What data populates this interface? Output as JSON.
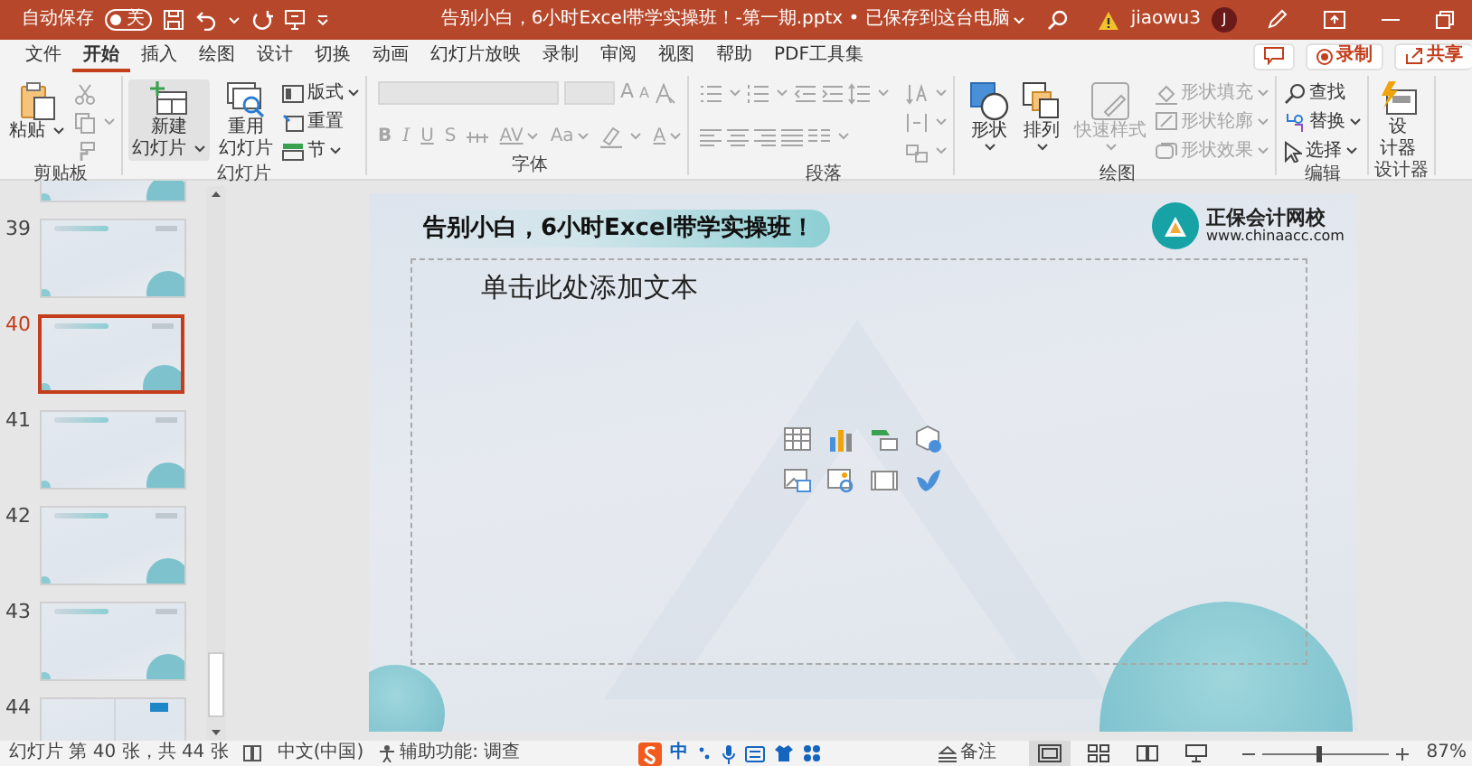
{
  "title_bar": {
    "autosave_label": "自动保存",
    "autosave": {
      "on": false,
      "label": "关"
    },
    "document_title": "告别小白，6小时Excel带学实操班！-第一期.pptx • 已保存到这台电脑",
    "account": "jiaowu3",
    "avatar_initial": "J"
  },
  "menu_tabs": [
    {
      "label": "文件",
      "selected": false
    },
    {
      "label": "开始",
      "selected": true
    },
    {
      "label": "插入",
      "selected": false
    },
    {
      "label": "绘图",
      "selected": false
    },
    {
      "label": "设计",
      "selected": false
    },
    {
      "label": "切换",
      "selected": false
    },
    {
      "label": "动画",
      "selected": false
    },
    {
      "label": "幻灯片放映",
      "selected": false
    },
    {
      "label": "录制",
      "selected": false
    },
    {
      "label": "审阅",
      "selected": false
    },
    {
      "label": "视图",
      "selected": false
    },
    {
      "label": "帮助",
      "selected": false
    },
    {
      "label": "PDF工具集",
      "selected": false
    }
  ],
  "record_button": "录制",
  "share_button": "共享",
  "ribbon": {
    "groups": [
      {
        "kind": "clipboard",
        "label": "剪贴板",
        "items": [
          {
            "lines": [
              "粘贴"
            ],
            "disabled": false
          },
          {
            "disabled": true
          },
          {
            "disabled": true
          },
          {
            "disabled": true
          }
        ]
      },
      {
        "kind": "slides",
        "label": "幻灯片",
        "items": [
          {
            "lines": [
              "新建",
              "幻灯片"
            ],
            "disabled": false
          },
          {
            "lines": [
              "重用",
              "幻灯片"
            ],
            "disabled": false
          },
          {
            "lines": [
              "版式"
            ],
            "disabled": false
          },
          {
            "lines": [
              "重置"
            ],
            "disabled": false
          },
          {
            "lines": [
              "节"
            ],
            "disabled": false
          }
        ]
      },
      {
        "kind": "font",
        "label": "字体",
        "items": [
          {
            "disabled": true
          },
          {
            "disabled": true
          },
          {
            "lines": [
              "A"
            ],
            "disabled": true
          },
          {
            "lines": [
              "A"
            ],
            "disabled": true
          },
          {
            "disabled": true
          },
          {
            "lines": [
              "B"
            ],
            "disabled": true
          },
          {
            "lines": [
              "I"
            ],
            "disabled": true
          },
          {
            "lines": [
              "U"
            ],
            "disabled": true
          },
          {
            "lines": [
              "S"
            ],
            "disabled": true
          },
          {
            "disabled": true
          },
          {
            "lines": [
              "AV"
            ],
            "disabled": true
          },
          {
            "lines": [
              "Aa"
            ],
            "disabled": true
          },
          {
            "disabled": true
          },
          {
            "lines": [
              "A"
            ],
            "disabled": true
          }
        ]
      },
      {
        "kind": "paragraph",
        "label": "段落",
        "items": [
          {
            "disabled": true
          },
          {
            "disabled": true
          },
          {
            "disabled": true
          },
          {
            "disabled": true
          },
          {
            "disabled": true
          },
          {
            "disabled": true
          },
          {
            "disabled": true
          },
          {
            "disabled": true
          },
          {
            "disabled": true
          },
          {
            "disabled": true
          },
          {
            "disabled": true
          },
          {
            "disabled": true
          },
          {
            "disabled": true
          }
        ]
      },
      {
        "kind": "drawing",
        "label": "绘图",
        "items": [
          {
            "lines": [
              "形状"
            ],
            "disabled": false
          },
          {
            "lines": [
              "排列"
            ],
            "disabled": false
          },
          {
            "lines": [
              "快速样式"
            ],
            "disabled": true
          },
          {
            "lines": [
              "形状填充"
            ],
            "disabled": true
          },
          {
            "lines": [
              "形状轮廓"
            ],
            "disabled": true
          },
          {
            "lines": [
              "形状效果"
            ],
            "disabled": true
          }
        ]
      },
      {
        "kind": "editing",
        "label": "编辑",
        "items": [
          {
            "lines": [
              "查找"
            ],
            "disabled": false
          },
          {
            "lines": [
              "替换"
            ],
            "disabled": false
          },
          {
            "lines": [
              "选择"
            ],
            "disabled": false
          }
        ]
      },
      {
        "kind": "designer",
        "label": "设计器",
        "items": [
          {
            "lines": [
              "设",
              "计器"
            ],
            "disabled": false
          }
        ]
      }
    ]
  },
  "slides": [
    {
      "kind": "plain",
      "selected": false
    },
    {
      "number": "39",
      "kind": "plain",
      "selected": false
    },
    {
      "number": "40",
      "kind": "plain",
      "selected": true
    },
    {
      "number": "41",
      "kind": "plain",
      "selected": false
    },
    {
      "number": "42",
      "kind": "plain",
      "selected": false
    },
    {
      "number": "43",
      "kind": "plain",
      "selected": false
    },
    {
      "number": "44",
      "kind": "accent",
      "selected": false
    }
  ],
  "slide": {
    "title": "告别小白，6小时Excel带学实操班！",
    "logo_name": "正保会计网校",
    "logo_url": "www.chinaacc.com",
    "placeholder": "单击此处添加文本"
  },
  "status_bar": {
    "slide_position": "幻灯片 第 40 张，共 44 张",
    "language": "中文(中国)",
    "accessibility": "辅助功能: 调查",
    "ime_mode": "中",
    "notes": "备注",
    "views": [
      {
        "selected": true
      },
      {
        "selected": false
      },
      {
        "selected": false
      },
      {
        "selected": false
      }
    ],
    "zoom": {
      "level": 0.45
    },
    "zoom_text": "87%"
  }
}
